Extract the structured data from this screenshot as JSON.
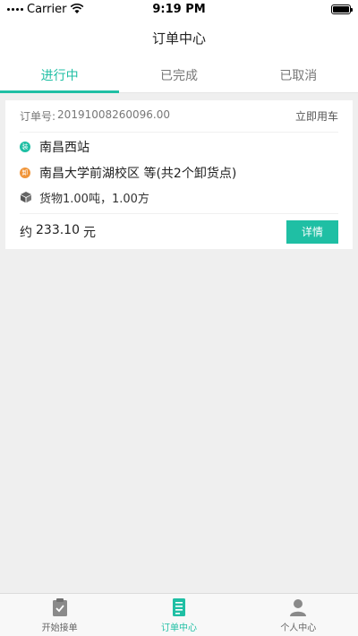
{
  "status_bar": {
    "carrier": "Carrier",
    "time": "9:19 PM",
    "icons": [
      "signal-icon",
      "wifi-icon",
      "battery-icon"
    ]
  },
  "nav": {
    "title": "订单中心"
  },
  "tabs": [
    {
      "label": "进行中",
      "active": true
    },
    {
      "label": "已完成",
      "active": false
    },
    {
      "label": "已取消",
      "active": false
    }
  ],
  "order": {
    "number_label": "订单号:",
    "number_value": "20191008260096.00",
    "type": "立即用车",
    "load_badge": "装",
    "load_address": "南昌西站",
    "unload_badge": "卸",
    "unload_address": "南昌大学前湖校区 等(共2个卸货点)",
    "goods": "货物1.00吨，1.00方",
    "price_prefix": "约",
    "price_value": "233.10",
    "price_unit": "元",
    "detail_button": "详情"
  },
  "bottom_tabs": [
    {
      "label": "开始接单",
      "icon": "clipboard-check-icon",
      "active": false
    },
    {
      "label": "订单中心",
      "icon": "list-document-icon",
      "active": true
    },
    {
      "label": "个人中心",
      "icon": "person-icon",
      "active": false
    }
  ],
  "colors": {
    "accent": "#1fbfa4",
    "unload": "#f0953a",
    "background": "#efefef"
  }
}
